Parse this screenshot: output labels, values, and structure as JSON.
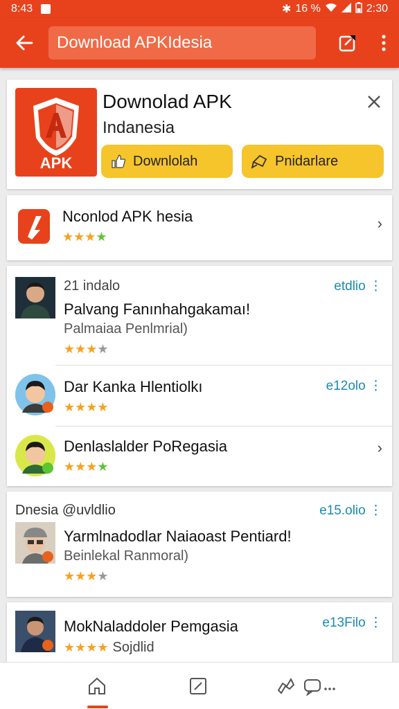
{
  "status_bar": {
    "time_left": "8:43",
    "battery_text": "16 %",
    "time_right": "2:30"
  },
  "app_bar": {
    "search_value": "Download APKIdesia"
  },
  "hero": {
    "title": "Downolad APK",
    "subtitle": "Indanesia",
    "logo_text": "APK",
    "download_label": "Downlolah",
    "secondary_label": "Pnidarlare"
  },
  "app_item": {
    "title": "Nconlod APK hesia",
    "rating": 3.5
  },
  "reviews": [
    {
      "meta": "21 indalo",
      "title": "Palvang Fanınhahgakamaı!",
      "sub": "Palmaiaa Penlmrial)",
      "date": "etdlio",
      "rating": 3
    },
    {
      "meta": "",
      "title": "Dar Kanka Hlentiolkı",
      "sub": "",
      "date": "e12olo",
      "rating": 4
    },
    {
      "meta": "",
      "title": "Denlaslalder PoRegasia",
      "sub": "",
      "date": "",
      "rating": 3.5
    },
    {
      "meta": "Dnesia @uvldlio",
      "title": "Yarmlnadodlar Naiaoast Pentiard!",
      "sub": "Beinlekal Ranmoral)",
      "date": "e15.olio",
      "rating": 3
    },
    {
      "meta": "",
      "title": "MokNaladdoler Pemgasia",
      "sub": "Sojdlid",
      "date": "e13Filo",
      "rating": 4
    }
  ],
  "icons": {
    "back": "arrow-left-icon",
    "edit": "edit-icon",
    "more": "more-vert-icon",
    "close": "close-icon",
    "home": "home-icon",
    "compose": "compose-icon",
    "share": "share-icon",
    "chat": "chat-icon"
  },
  "colors": {
    "primary": "#e8421c",
    "button_yellow": "#f6c42b",
    "date_blue": "#1a8ab0",
    "star_orange": "#f6a21d",
    "star_green": "#5cc531"
  }
}
